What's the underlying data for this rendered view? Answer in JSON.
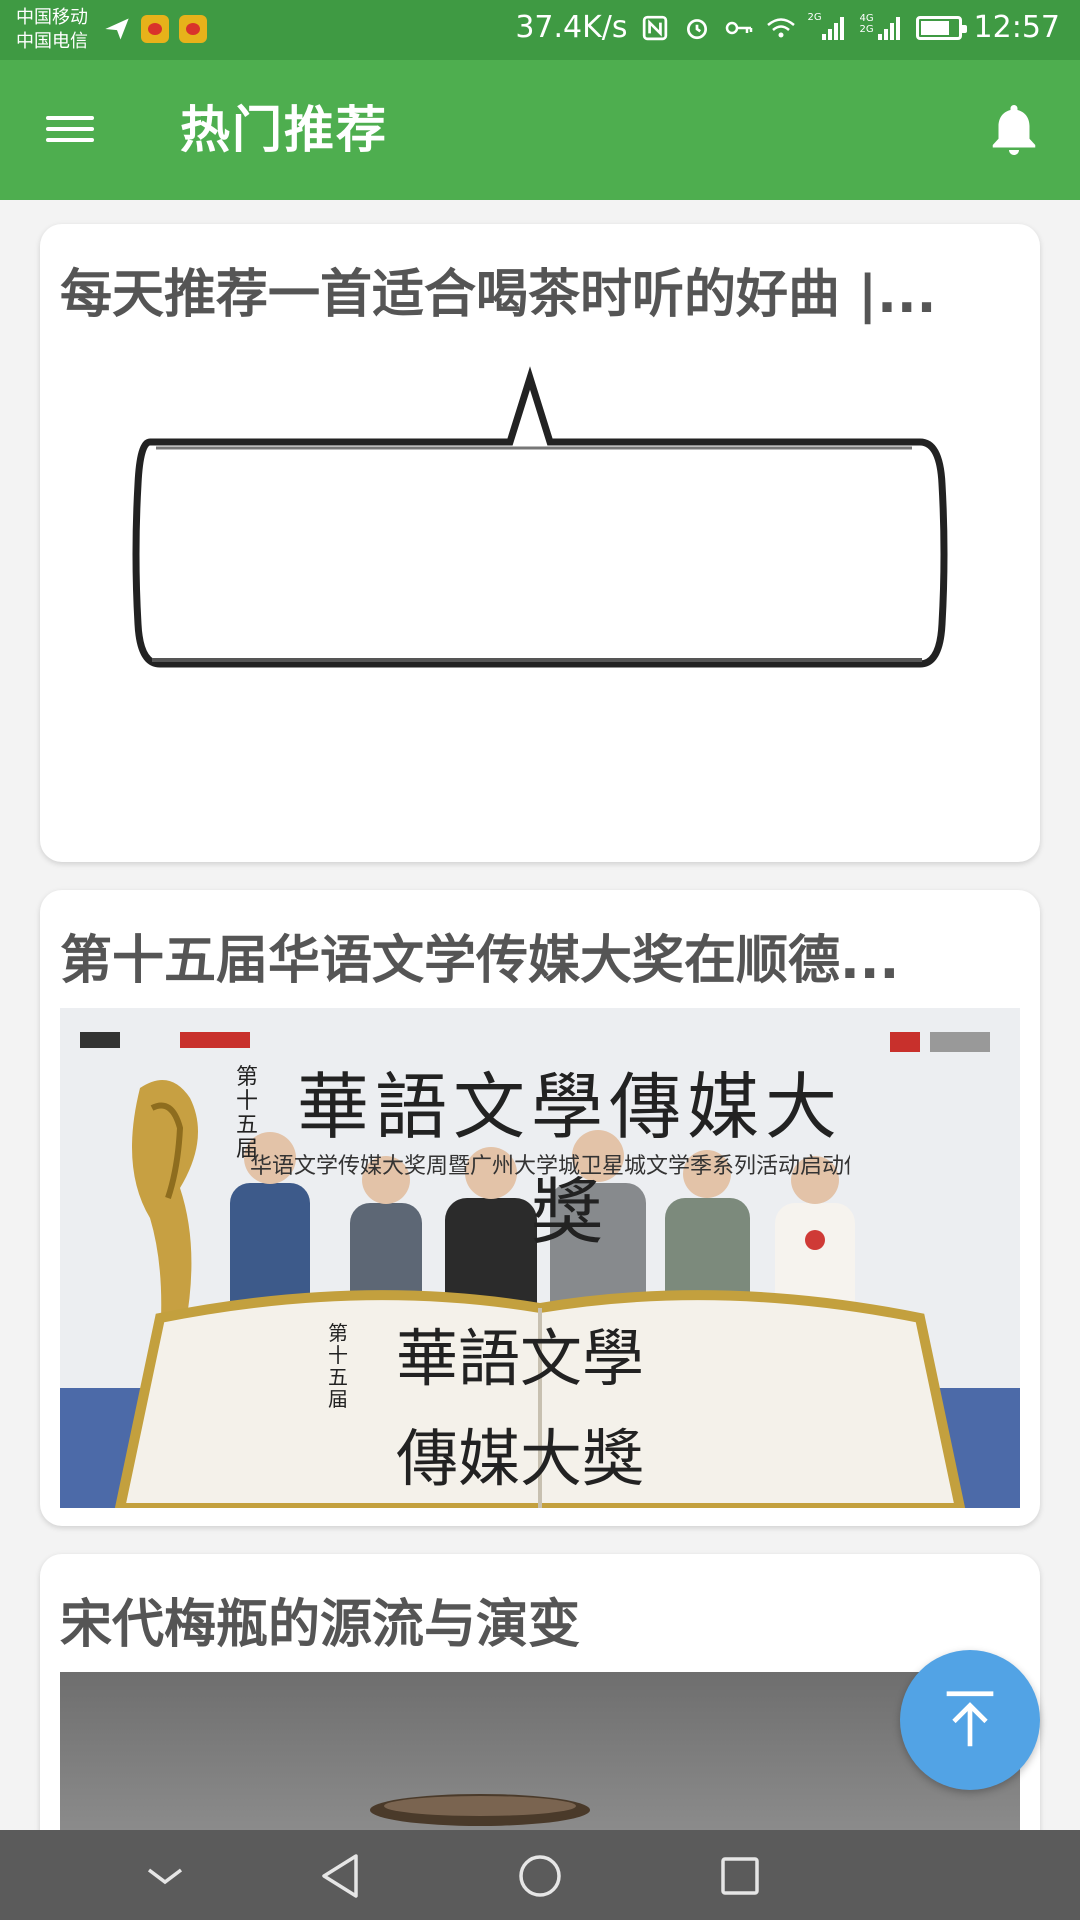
{
  "status_bar": {
    "carrier_1": "中国移动",
    "carrier_2": "中国电信",
    "speed": "37.4K/s",
    "network_1": "2G",
    "network_2": "4G",
    "network_3": "2G",
    "time": "12:57"
  },
  "app_bar": {
    "title": "热门推荐"
  },
  "cards": [
    {
      "title": "每天推荐一首适合喝茶时听的好曲 |..."
    },
    {
      "title": "第十五届华语文学传媒大奖在顺德..."
    },
    {
      "title": "宋代梅瓶的源流与演变"
    }
  ],
  "poster": {
    "line_top": "華語文學傳媒大獎",
    "line_top_side": "第十五届",
    "sub": "华语文学传媒大奖周暨广州大学城卫星城文学季系列活动启动仪式",
    "book_left": "華語文學",
    "book_right": "傳媒大獎",
    "book_side": "第十五届"
  },
  "colors": {
    "status_bar": "#3f9a43",
    "app_bar": "#4eae4f",
    "fab": "#52a3e5",
    "nav_bar": "#5b5b5b",
    "title_text": "#555555"
  }
}
